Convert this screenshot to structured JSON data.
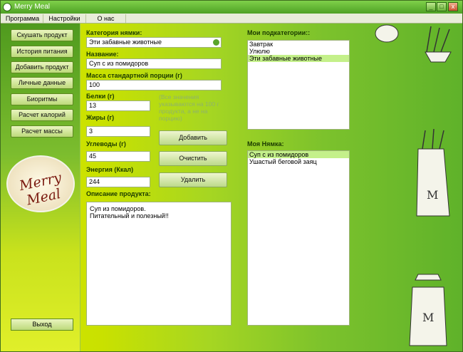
{
  "window": {
    "title": "Merry Meal",
    "minimize": "_",
    "maximize": "□",
    "close": "x"
  },
  "menu": [
    "Программа",
    "Настройки",
    "О нас"
  ],
  "sidebar": {
    "items": [
      "Скушать продукт",
      "История питания",
      "Добавить продукт",
      "Личные данные",
      "Биоритмы",
      "Расчет калорий",
      "Расчет массы"
    ],
    "logo": "Merry Meal",
    "exit": "Выход"
  },
  "form": {
    "category_label": "Категория нямки:",
    "category_value": "Эти забавные животные",
    "name_label": "Название:",
    "name_value": "Суп с из помидоров",
    "mass_label": "Масса стандартной порции (г)",
    "mass_value": "100",
    "protein_label": "Белки (г)",
    "protein_value": "13",
    "fat_label": "Жиры (г)",
    "fat_value": "3",
    "carb_label": "Углеводы (г)",
    "carb_value": "45",
    "energy_label": "Энергия (Ккал)",
    "energy_value": "244",
    "hint": "(Все значения указываются на 100 г продукта, а не на порцию)",
    "desc_label": "Описание продукта:",
    "desc_line1": "Суп из помидоров.",
    "desc_line2": "Питательный и полезный!!"
  },
  "buttons": {
    "add": "Добавить",
    "clear": "Очистить",
    "delete": "Удалить"
  },
  "subcategories": {
    "label": "Мои подкатегории::",
    "items": [
      "Завтрак",
      "Улюлю",
      "Эти забавные животные"
    ]
  },
  "mine": {
    "label": "Моя Нямка:",
    "items": [
      "Суп с из помидоров",
      "Ушастый беговой заяц"
    ]
  }
}
